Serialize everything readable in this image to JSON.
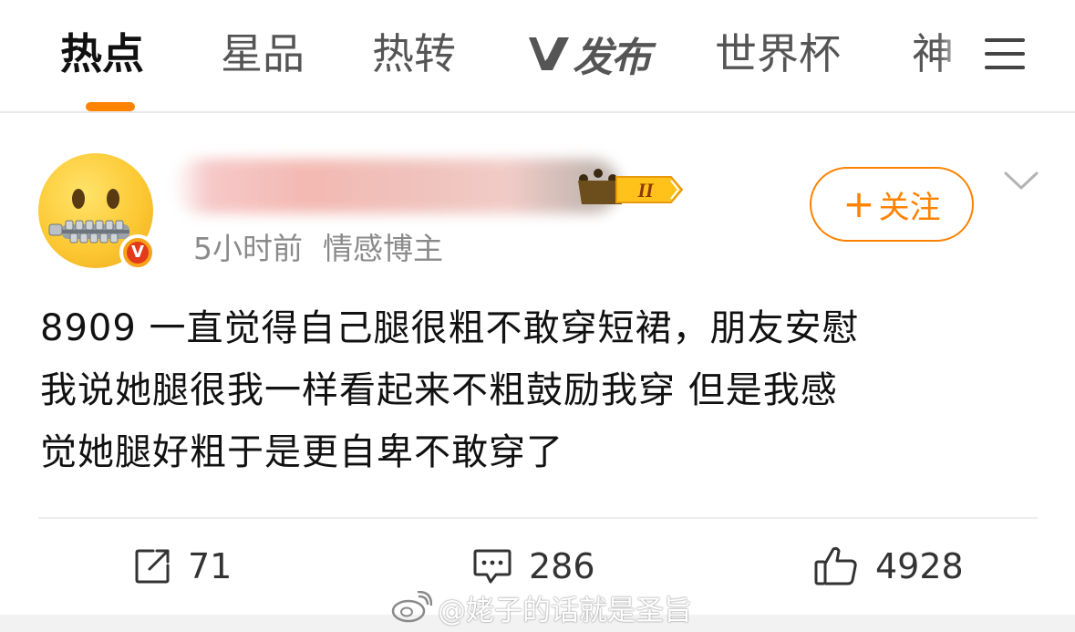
{
  "tabs": [
    {
      "label": "热点",
      "active": true
    },
    {
      "label": "星品",
      "active": false
    },
    {
      "label": "热转",
      "active": false
    },
    {
      "label": "发布",
      "logo": "v-logo-icon",
      "active": false
    },
    {
      "label": "世界杯",
      "active": false
    },
    {
      "label": "神",
      "active": false
    }
  ],
  "colors": {
    "accent": "#ff8200",
    "text": "#111111",
    "muted": "#8a8a8a"
  },
  "post": {
    "avatar_icon": "zipper-mouth-face-emoji",
    "verified_icon": "verified-v-badge-icon",
    "verified_mark": "V",
    "level_badge": "II",
    "time": "5小时前",
    "author_tag": "情感博主",
    "follow_plus": "+",
    "follow_label": "关注",
    "text_lines": [
      "8909 一直觉得自己腿很粗不敢穿短裙，朋友安慰",
      "我说她腿很我一样看起来不粗鼓励我穿  但是我感",
      "觉她腿好粗于是更自卑不敢穿了"
    ]
  },
  "actions": {
    "repost_count": "71",
    "comment_count": "286",
    "like_count": "4928"
  },
  "watermark": "@姥子的话就是圣旨"
}
